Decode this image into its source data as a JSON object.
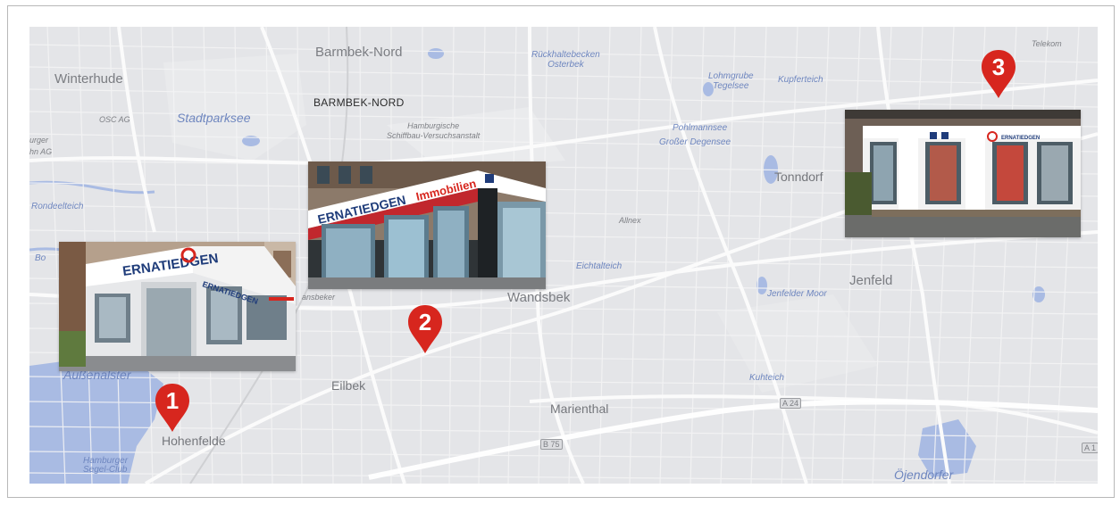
{
  "map": {
    "labels": {
      "barmbek_nord": "Barmbek-Nord",
      "barmbek_nord_caps": "BARMBEK-NORD",
      "winterhude": "Winterhude",
      "osc_ag": "OSC AG",
      "stadtparksee": "Stadtparksee",
      "burger": "urger",
      "hn_ag": "hn AG",
      "rondeelteich": "Rondeelteich",
      "bo": "Bo",
      "aussenalster": "Außenalster",
      "hohenfelde": "Hohenfelde",
      "hamburger_segel": "Hamburger\nSegel-Club",
      "eilbek": "Eilbek",
      "wandsbek": "Wandsbek",
      "marienthal": "Marienthal",
      "jenfeld": "Jenfeld",
      "tonndorf": "Tonndorf",
      "ojendorfer": "Öjendorfer",
      "telekom": "Telekom",
      "rueckhaltebecken": "Rückhaltebecken\nOsterbek",
      "hsva": "Hamburgische\nSchiffbau-Versuchsanstalt",
      "loehmgrube": "Lohmgrube\nTegelsee",
      "kuhteich_top": "Kupferteich",
      "pohlmannsee": "Pohlmannsee",
      "grosser_degensee": "Großer Degensee",
      "eichtalteich": "Eichtalteich",
      "jenfelder_moor": "Jenfelder Moor",
      "kuhteich": "Kuhteich",
      "allnex": "Allnex",
      "wandsbeker_kurz": "ansbeker",
      "road_code_a24": "A 24",
      "road_code_b75": "B 75",
      "road_code_a1": "A 1"
    },
    "markers": [
      {
        "number": "1",
        "color": "#d7261e"
      },
      {
        "number": "2",
        "color": "#d7261e"
      },
      {
        "number": "3",
        "color": "#d7261e"
      }
    ],
    "photos": [
      {
        "sign": "ERNATIEDGEN",
        "sign_full": "MERNATIEDGEN"
      },
      {
        "sign": "ERNATIEDGEN",
        "suffix": "Immobilien"
      },
      {
        "sign": "ERNATIEDGEN"
      }
    ]
  }
}
